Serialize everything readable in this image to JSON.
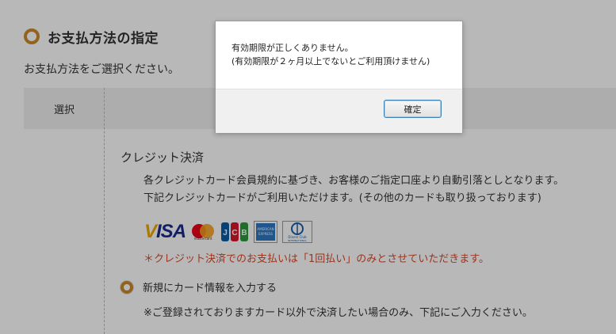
{
  "section": {
    "title": "お支払方法の指定",
    "instruction": "お支払方法をご選択ください。"
  },
  "table": {
    "select_header": "選択"
  },
  "credit": {
    "title": "クレジット決済",
    "description_line1": "各クレジットカード会員規約に基づき、お客様のご指定口座より自動引落としとなります。",
    "description_line2": "下記クレジットカードがご利用いただけます。(その他のカードも取り扱っております)",
    "logos": {
      "visa": "VISA",
      "mastercard": "mastercard",
      "jcb": "JCB",
      "amex": "AMERICAN EXPRESS",
      "diners": "Diners Club INTERNATIONAL"
    },
    "notice": "＊クレジット決済でのお支払いは「1回払い」のみとさせていただきます。",
    "new_card_option": "新規にカード情報を入力する",
    "note": "※ご登録されておりますカード以外で決済したい場合のみ、下記にご入力ください。"
  },
  "dialog": {
    "message_line1": "有効期限が正しくありません。",
    "message_line2": "(有効期限が２ヶ月以上でないとご利用頂けません)",
    "ok_label": "確定"
  },
  "colors": {
    "accent": "#c98a2a",
    "notice_red": "#d9492b",
    "overlay": "rgba(0,0,0,0.28)"
  }
}
